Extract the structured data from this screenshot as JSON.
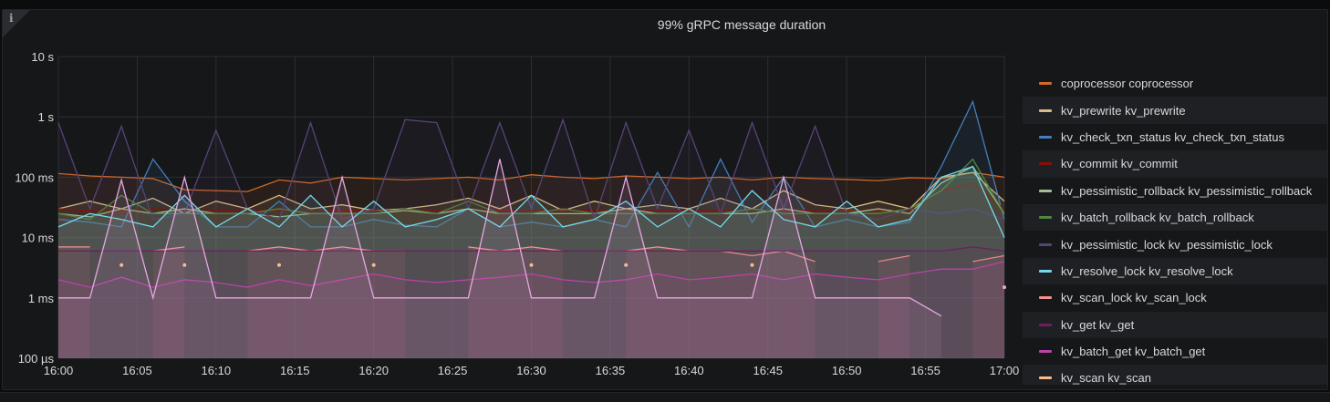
{
  "panel": {
    "title": "99% gRPC message duration",
    "info_icon": "info-icon"
  },
  "chart_data": {
    "type": "line",
    "title": "99% gRPC message duration",
    "yscale": "log",
    "yunit": "ms",
    "ylim": [
      0.1,
      10000
    ],
    "yticks": [
      {
        "v": 10000,
        "label": "10 s"
      },
      {
        "v": 1000,
        "label": "1 s"
      },
      {
        "v": 100,
        "label": "100 ms"
      },
      {
        "v": 10,
        "label": "10 ms"
      },
      {
        "v": 1,
        "label": "1 ms"
      },
      {
        "v": 0.1,
        "label": "100 µs"
      }
    ],
    "xticks": [
      "16:00",
      "16:05",
      "16:10",
      "16:15",
      "16:20",
      "16:25",
      "16:30",
      "16:35",
      "16:40",
      "16:45",
      "16:50",
      "16:55",
      "17:00"
    ],
    "xlim": [
      "16:00",
      "17:00"
    ],
    "x_step_minutes": 2,
    "grid": true,
    "legend_placement": "right",
    "fill": true,
    "series": [
      {
        "name": "coprocessor coprocessor",
        "color": "#d0692a",
        "values": [
          115,
          105,
          100,
          95,
          62,
          60,
          58,
          90,
          80,
          100,
          95,
          90,
          95,
          100,
          90,
          110,
          100,
          95,
          105,
          100,
          95,
          100,
          90,
          100,
          95,
          92,
          88,
          98,
          95,
          120,
          100
        ]
      },
      {
        "name": "kv_prewrite kv_prewrite",
        "color": "#d9bd86",
        "values": [
          30,
          40,
          30,
          45,
          25,
          40,
          30,
          50,
          30,
          35,
          28,
          30,
          35,
          45,
          30,
          50,
          28,
          40,
          30,
          35,
          30,
          45,
          30,
          60,
          35,
          30,
          40,
          30,
          100,
          120,
          40
        ]
      },
      {
        "name": "kv_check_txn_status kv_check_txn_status",
        "color": "#447ebc",
        "values": [
          20,
          18,
          15,
          200,
          40,
          15,
          15,
          40,
          15,
          15,
          20,
          16,
          15,
          30,
          15,
          18,
          15,
          20,
          15,
          120,
          15,
          200,
          18,
          100,
          15,
          20,
          15,
          18,
          150,
          1800,
          20
        ]
      },
      {
        "name": "kv_commit kv_commit",
        "color": "#890f02",
        "values": [
          30,
          28,
          28,
          30,
          28,
          28,
          28,
          28,
          27,
          28,
          28,
          28,
          28,
          28,
          28,
          28,
          28,
          28,
          28,
          28,
          28,
          28,
          28,
          28,
          28,
          28,
          28,
          28,
          60,
          80,
          30
        ]
      },
      {
        "name": "kv_pessimistic_rollback kv_pessimistic_rollback",
        "color": "#9fbf94",
        "values": [
          25,
          22,
          30,
          25,
          30,
          25,
          25,
          22,
          25,
          25,
          25,
          28,
          25,
          30,
          25,
          25,
          25,
          25,
          30,
          25,
          25,
          25,
          25,
          30,
          25,
          25,
          30,
          25,
          80,
          150,
          25
        ]
      },
      {
        "name": "kv_batch_rollback kv_batch_rollback",
        "color": "#508642",
        "values": [
          25,
          20,
          50,
          25,
          25,
          25,
          25,
          30,
          25,
          25,
          25,
          30,
          25,
          40,
          25,
          25,
          30,
          25,
          25,
          25,
          25,
          25,
          30,
          25,
          25,
          25,
          25,
          30,
          60,
          200,
          25
        ]
      },
      {
        "name": "kv_pessimistic_lock kv_pessimistic_lock",
        "color": "#584477",
        "values": [
          800,
          30,
          700,
          20,
          25,
          600,
          30,
          20,
          800,
          20,
          30,
          900,
          800,
          30,
          800,
          30,
          900,
          20,
          800,
          30,
          600,
          25,
          800,
          30,
          700,
          25,
          20,
          30,
          25,
          30,
          20
        ]
      },
      {
        "name": "kv_resolve_lock kv_resolve_lock",
        "color": "#70dbed",
        "values": [
          15,
          25,
          20,
          15,
          50,
          15,
          30,
          15,
          50,
          15,
          40,
          15,
          20,
          30,
          15,
          50,
          15,
          20,
          40,
          15,
          30,
          15,
          60,
          20,
          15,
          40,
          15,
          20,
          100,
          150,
          10
        ]
      },
      {
        "name": "kv_scan_lock kv_scan_lock",
        "color": "#f29191",
        "values": [
          7,
          7,
          null,
          6,
          7,
          null,
          6,
          7,
          6,
          7,
          6,
          6,
          null,
          7,
          6,
          7,
          6,
          null,
          6,
          7,
          6,
          6,
          5,
          6,
          4,
          null,
          4,
          5,
          null,
          4,
          5
        ]
      },
      {
        "name": "kv_get kv_get",
        "color": "#6d1f62",
        "values": [
          6,
          6,
          6,
          6,
          6,
          6,
          6,
          6,
          6,
          6,
          6,
          6,
          6,
          6,
          6,
          6,
          6,
          6,
          6,
          6,
          6,
          6,
          6,
          6,
          6,
          6,
          6,
          6,
          6,
          7,
          6
        ]
      },
      {
        "name": "kv_batch_get kv_batch_get",
        "color": "#ba43a9",
        "values": [
          2,
          1.5,
          2.2,
          1.5,
          2,
          1.8,
          1.5,
          2,
          1.6,
          2,
          2.5,
          2,
          1.8,
          2,
          2.2,
          2.5,
          2,
          1.8,
          2,
          2.5,
          2,
          2.2,
          2.5,
          2,
          2.5,
          2.2,
          2,
          2.5,
          3,
          3,
          4
        ]
      },
      {
        "name": "kv_scan kv_scan",
        "color": "#f9ba8f",
        "values": [
          null,
          null,
          3.5,
          null,
          3.5,
          null,
          null,
          3.5,
          null,
          null,
          3.5,
          null,
          null,
          null,
          null,
          3.5,
          null,
          null,
          3.5,
          null,
          null,
          null,
          3.5,
          null,
          null,
          null,
          null,
          null,
          null,
          null,
          null
        ]
      },
      {
        "color": "#e5a8e2",
        "values": [
          1,
          1,
          90,
          1,
          100,
          1,
          1,
          1,
          1,
          100,
          1,
          1,
          1,
          1,
          200,
          1,
          1,
          1,
          100,
          1,
          1,
          1,
          1,
          100,
          1,
          1,
          1,
          1,
          0.5,
          null,
          1.5
        ]
      }
    ]
  }
}
